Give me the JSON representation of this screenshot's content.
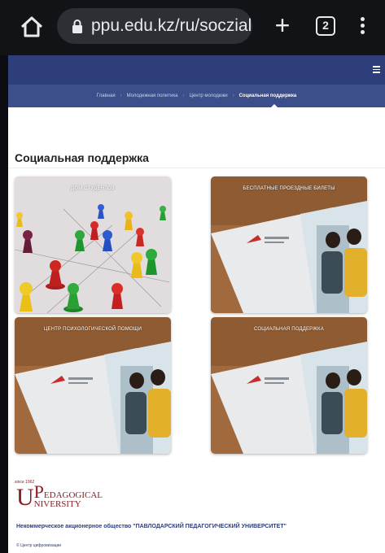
{
  "browser": {
    "url": "ppu.edu.kz/ru/soczial",
    "tab_count": "2",
    "icons": [
      "home-icon",
      "lock-icon",
      "new-tab-icon",
      "tab-switcher-icon",
      "more-menu-icon"
    ]
  },
  "site": {
    "nav_color": "#2d3e7a",
    "breadcrumb": [
      {
        "label": "Главная"
      },
      {
        "label": "Молодежная политика"
      },
      {
        "label": "Центр молодежи"
      },
      {
        "label": "Социальная поддержка"
      }
    ]
  },
  "page": {
    "title": "Социальная поддержка",
    "cards": [
      {
        "label": "ДОМ СТУДЕНТОВ"
      },
      {
        "label": "БЕСПЛАТНЫЕ ПРОЕЗДНЫЕ БИЛЕТЫ"
      },
      {
        "label": "ЦЕНТР ПСИХОЛОГИЧЕСКОЙ ПОМОЩИ"
      },
      {
        "label": "СОЦИАЛЬНАЯ ПОДДЕРЖКА"
      }
    ]
  },
  "footer": {
    "logo_year": "since 1962",
    "logo_letter": "U",
    "logo_p": "P",
    "logo_line1": "EDAGOGICAL",
    "logo_line2": "NIVERSITY",
    "org": "Некоммерческое акционерное общество \"ПАВЛОДАРСКИЙ ПЕДАГОГИЧЕСКИЙ УНИВЕРСИТЕТ\"",
    "note": "© Центр цифровизации"
  }
}
